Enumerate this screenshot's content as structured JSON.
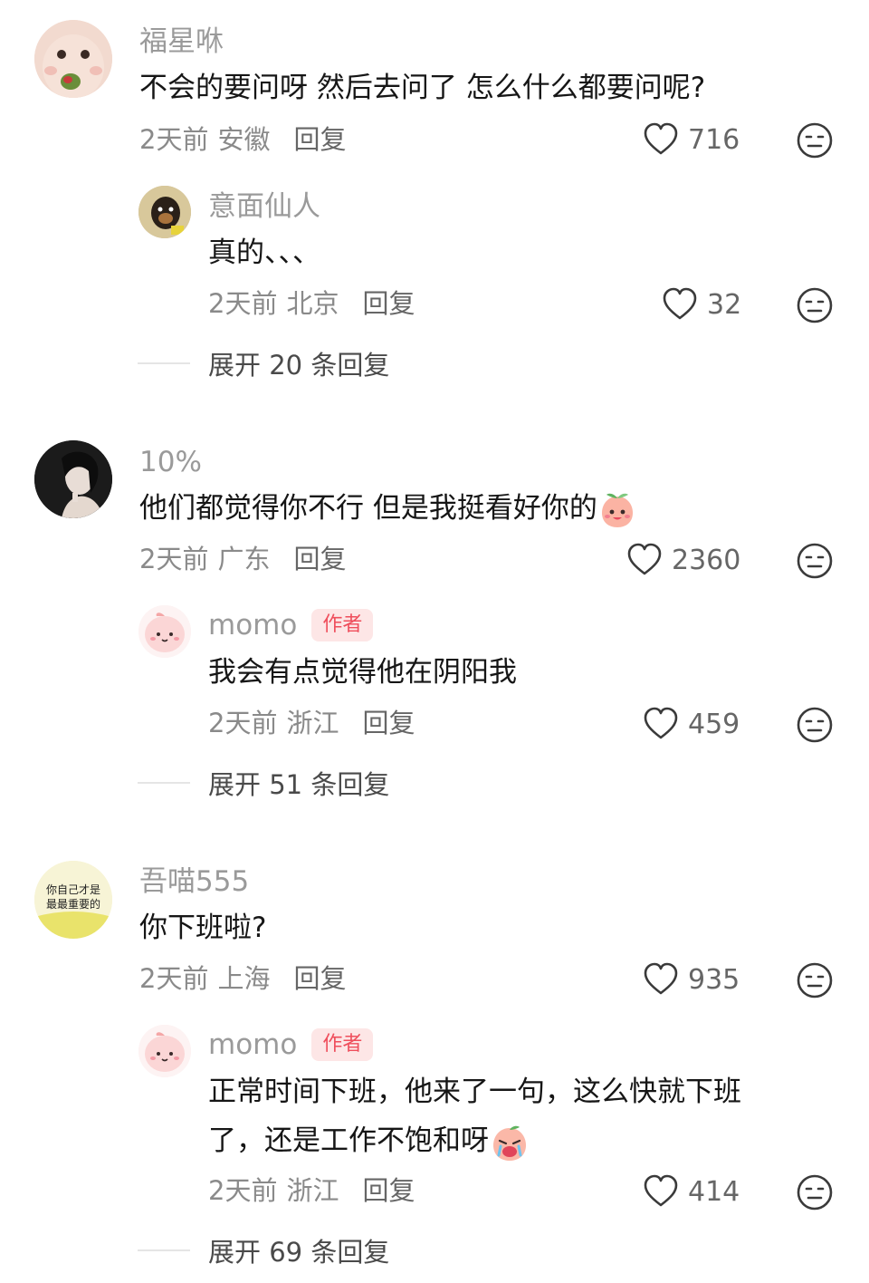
{
  "comments": [
    {
      "user": "福星咻",
      "text": "不会的要问呀  然后去问了  怎么什么都要问呢?",
      "time": "2天前",
      "location": "安徽",
      "reply_label": "回复",
      "likes": "716",
      "replies": [
        {
          "user": "意面仙人",
          "text": "真的、、、",
          "time": "2天前",
          "location": "北京",
          "reply_label": "回复",
          "likes": "32"
        }
      ],
      "expand_label": "展开 20 条回复"
    },
    {
      "user": "10%",
      "text": "他们都觉得你不行 但是我挺看好你的",
      "time": "2天前",
      "location": "广东",
      "reply_label": "回复",
      "likes": "2360",
      "replies": [
        {
          "user": "momo",
          "badge": "作者",
          "text": "我会有点觉得他在阴阳我",
          "time": "2天前",
          "location": "浙江",
          "reply_label": "回复",
          "likes": "459"
        }
      ],
      "expand_label": "展开 51 条回复"
    },
    {
      "user": "吾喵555",
      "avatar_text": [
        "你自己才是",
        "最最重要的"
      ],
      "text": "你下班啦?",
      "time": "2天前",
      "location": "上海",
      "reply_label": "回复",
      "likes": "935",
      "replies": [
        {
          "user": "momo",
          "badge": "作者",
          "text_line1": "正常时间下班，他来了一句，这么快就下班",
          "text_line2": "了，还是工作不饱和呀",
          "time": "2天前",
          "location": "浙江",
          "reply_label": "回复",
          "likes": "414"
        }
      ],
      "expand_label": "展开 69 条回复"
    }
  ],
  "icons": {
    "like": "heart-outline-icon",
    "dislike": "unamused-face-icon",
    "emoji_peach": "peach-smile-emoji",
    "emoji_cry": "peach-crying-emoji"
  },
  "colors": {
    "name": "#9a9a9a",
    "text": "#161616",
    "meta": "#8a8a8a",
    "author_badge_bg": "#fde6e6",
    "author_badge_text": "#ef4e5c"
  }
}
